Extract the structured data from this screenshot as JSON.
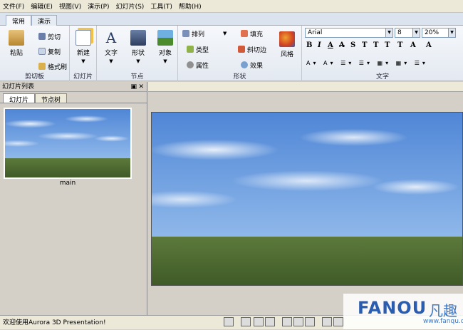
{
  "menu": [
    "文件(F)",
    "编辑(E)",
    "视图(V)",
    "演示(P)",
    "幻灯片(S)",
    "工具(T)",
    "帮助(H)"
  ],
  "tabs": [
    "常用",
    "演示"
  ],
  "ribbon": {
    "clipboard": {
      "label": "剪切板",
      "paste": "粘贴",
      "cut": "剪切",
      "copy": "复制",
      "format_painter": "格式刷"
    },
    "slides": {
      "label": "幻灯片",
      "new": "新建"
    },
    "nodes": {
      "label": "节点",
      "text": "文字",
      "shape": "形状",
      "object": "对象"
    },
    "shapes": {
      "label": "形状",
      "arrange": "排列",
      "type": "类型",
      "property": "属性",
      "fill": "填充",
      "bevel": "斜切边",
      "effect": "效果",
      "style": "风格"
    },
    "text": {
      "label": "文字",
      "font": "Arial",
      "size": "8",
      "zoom": "20%"
    }
  },
  "panel": {
    "title": "幻灯片列表",
    "tabs": [
      "幻灯片",
      "节点树"
    ],
    "thumb_caption": "main"
  },
  "status": {
    "message": "欢迎使用Aurora 3D Presentation!"
  },
  "watermark": {
    "brand": "FANOU",
    "cn": "凡趣",
    "url": "www.fanqu.cn"
  },
  "colors": {
    "accent": "#4f86d6",
    "ribbon": "#e3e9f1"
  }
}
